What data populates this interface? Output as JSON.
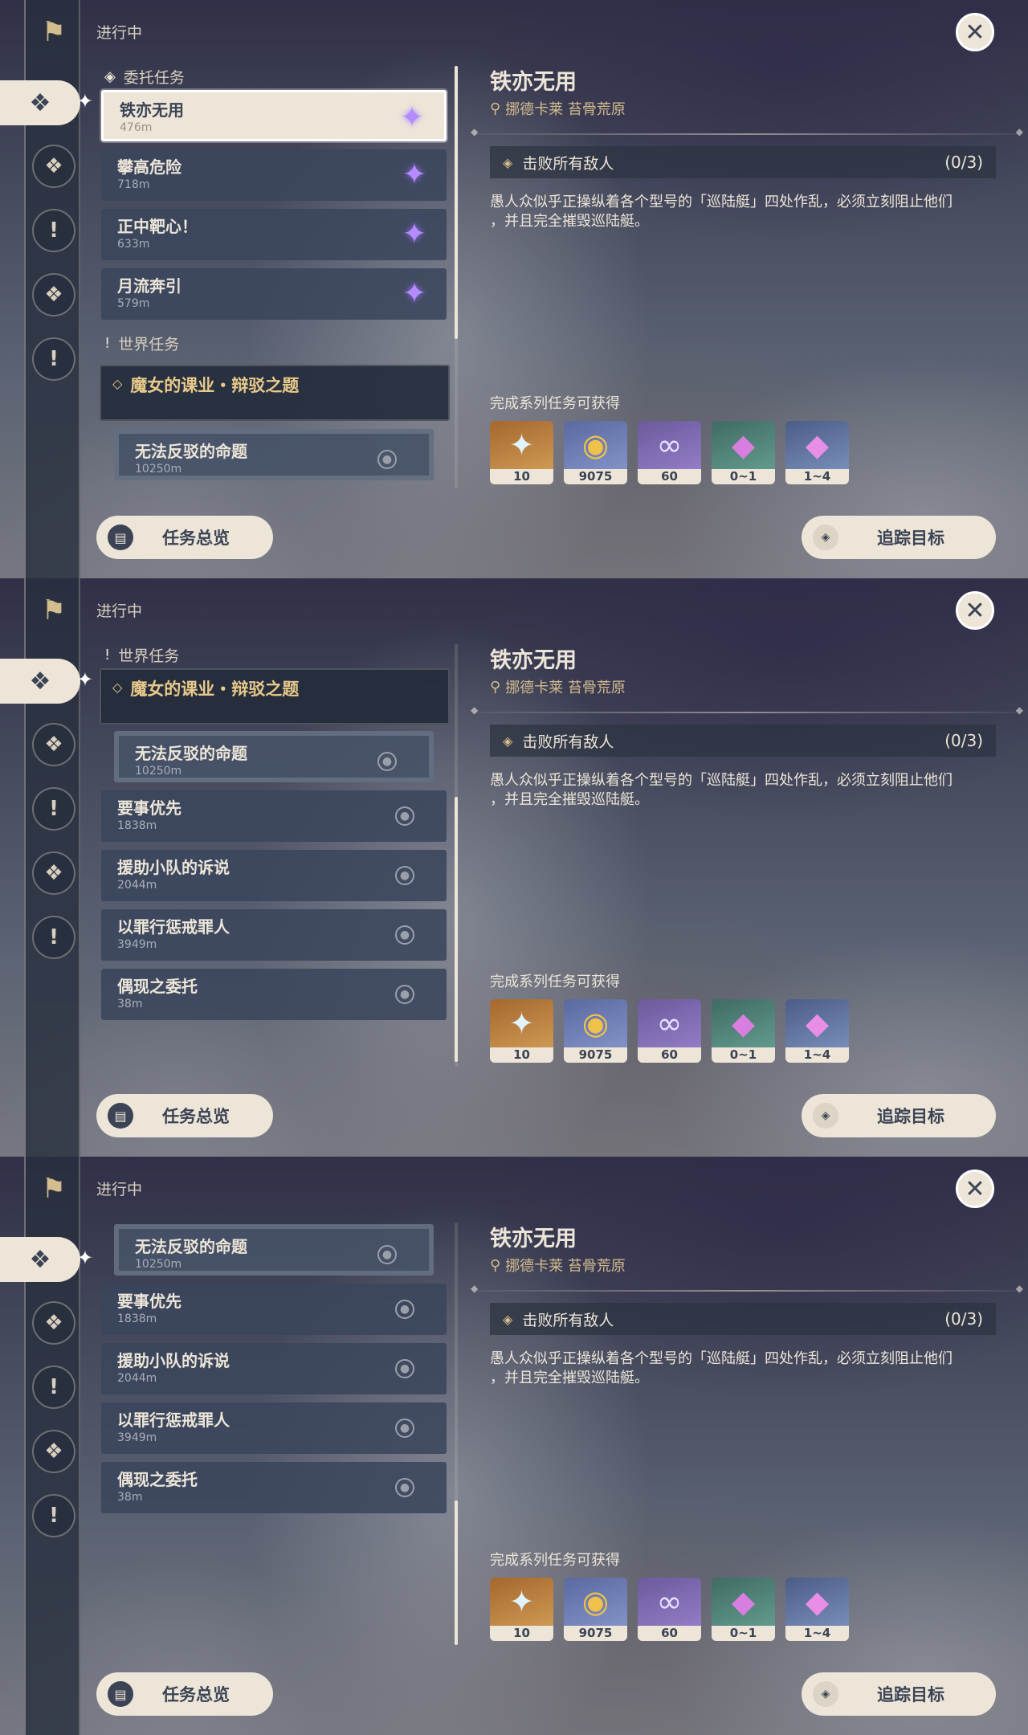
{
  "header": {
    "status_label": "进行中",
    "close_icon": "close-icon"
  },
  "rail": {
    "icons": [
      "quest-scroll-icon",
      "commission-icon",
      "archon-quest-icon",
      "story-quest-icon",
      "event-quest-icon",
      "world-quest-icon"
    ]
  },
  "sections": {
    "commission": "委托任务",
    "world": "世界任务"
  },
  "commissions": [
    {
      "title": "铁亦无用",
      "distance": "476m"
    },
    {
      "title": "攀高危险",
      "distance": "718m"
    },
    {
      "title": "正中靶心！",
      "distance": "633m"
    },
    {
      "title": "月流奔引",
      "distance": "579m"
    }
  ],
  "world_quest": {
    "series": "魔女的课业・辩驳之题",
    "subquest": {
      "title": "无法反驳的命题",
      "distance": "10250m"
    }
  },
  "world_quests_more": [
    {
      "title": "要事优先",
      "distance": "1838m"
    },
    {
      "title": "援助小队的诉说",
      "distance": "2044m"
    },
    {
      "title": "以罪行惩戒罪人",
      "distance": "3949m"
    },
    {
      "title": "偶现之委托",
      "distance": "38m"
    }
  ],
  "detail": {
    "title": "铁亦无用",
    "location": "挪德卡莱 苔骨荒原",
    "objective": "击败所有敌人",
    "progress": "(0/3)",
    "description_line1": "愚人众似乎正操纵着各个型号的「巡陆艇」四处作乱，必须立刻阻止他们",
    "description_line2": "，并且完全摧毁巡陆艇。",
    "rewards_label": "完成系列任务可获得",
    "rewards": [
      {
        "icon": "primogem-icon",
        "count": "10"
      },
      {
        "icon": "mora-icon",
        "count": "9075"
      },
      {
        "icon": "friendship-exp-icon",
        "count": "60"
      },
      {
        "icon": "green-crystal-icon",
        "count": "0~1"
      },
      {
        "icon": "pink-crystal-icon",
        "count": "1~4"
      }
    ]
  },
  "buttons": {
    "overview": "任务总览",
    "track": "追踪目标"
  },
  "scroll": {
    "panel1_thumb_fraction": 0.42,
    "panel2_thumb_fraction": 0.45,
    "panel3_thumb_fraction": 0.36
  }
}
